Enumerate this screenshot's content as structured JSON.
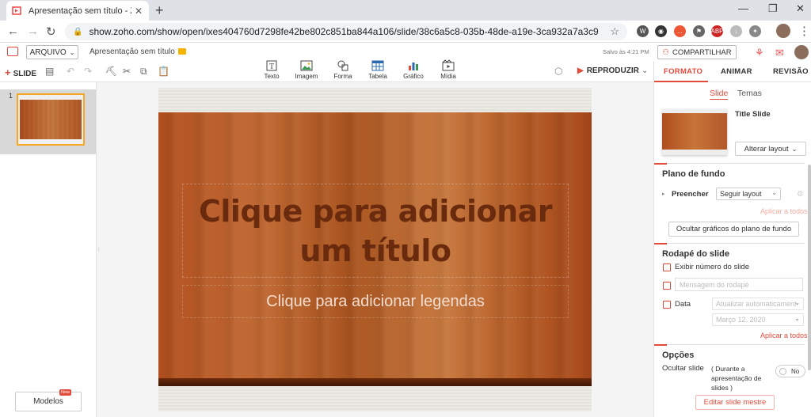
{
  "browser": {
    "tab_title": "Apresentação sem título - Zoho S",
    "url": "show.zoho.com/show/open/ixes404760d7298fe42be802c851ba844a106/slide/38c6a5c8-035b-48de-a19e-3ca932a7a3c9",
    "ext_badges": {
      "abp": "ABP",
      "red": "..."
    }
  },
  "header": {
    "file_label": "ARQUIVO",
    "doc_title": "Apresentação sem título",
    "saved_status": "Salvo às 4:21 PM",
    "share_label": "COMPARTILHAR"
  },
  "toolbar": {
    "add_slide_label": "SLIDE",
    "insert": [
      {
        "label": "Texto",
        "icon": "text-box-icon"
      },
      {
        "label": "Imagem",
        "icon": "image-icon"
      },
      {
        "label": "Forma",
        "icon": "shape-icon"
      },
      {
        "label": "Tabela",
        "icon": "table-icon"
      },
      {
        "label": "Gráfico",
        "icon": "chart-icon"
      },
      {
        "label": "Mídia",
        "icon": "media-icon"
      }
    ],
    "play_label": "REPRODUZIR"
  },
  "slides_panel": {
    "slide_number": "1",
    "templates_label": "Modelos",
    "new_badge": "New"
  },
  "slide": {
    "title_placeholder": "Clique para adicionar um título",
    "subtitle_placeholder": "Clique para adicionar legendas"
  },
  "right_panel": {
    "tabs": [
      "FORMATO",
      "ANIMAR",
      "REVISÃO"
    ],
    "subtabs": [
      "Slide",
      "Temas"
    ],
    "layout_name": "Title Slide",
    "change_layout": "Alterar layout",
    "background": {
      "heading": "Plano de fundo",
      "fill_label": "Preencher",
      "fill_value": "Seguir layout",
      "apply_all": "Aplicar a todos",
      "hide_graphics": "Ocultar gráficos do plano de fundo"
    },
    "footer": {
      "heading": "Rodapé do slide",
      "show_number": "Exibir número do slide",
      "footer_placeholder": "Mensagem do rodapé",
      "date_label": "Data",
      "date_mode": "Atualizar automaticament",
      "date_value": "Março 12, 2020",
      "apply_all": "Aplicar a todos"
    },
    "options": {
      "heading": "Opções",
      "hide_slide": "Ocultar slide",
      "hide_slide_note": "( Durante a apresentação de slides )",
      "toggle_value": "No",
      "edit_master": "Editar slide mestre"
    }
  },
  "colors": {
    "accent": "#e04b3c",
    "wood": "#b35a24",
    "title_text": "#6a2a0d"
  }
}
